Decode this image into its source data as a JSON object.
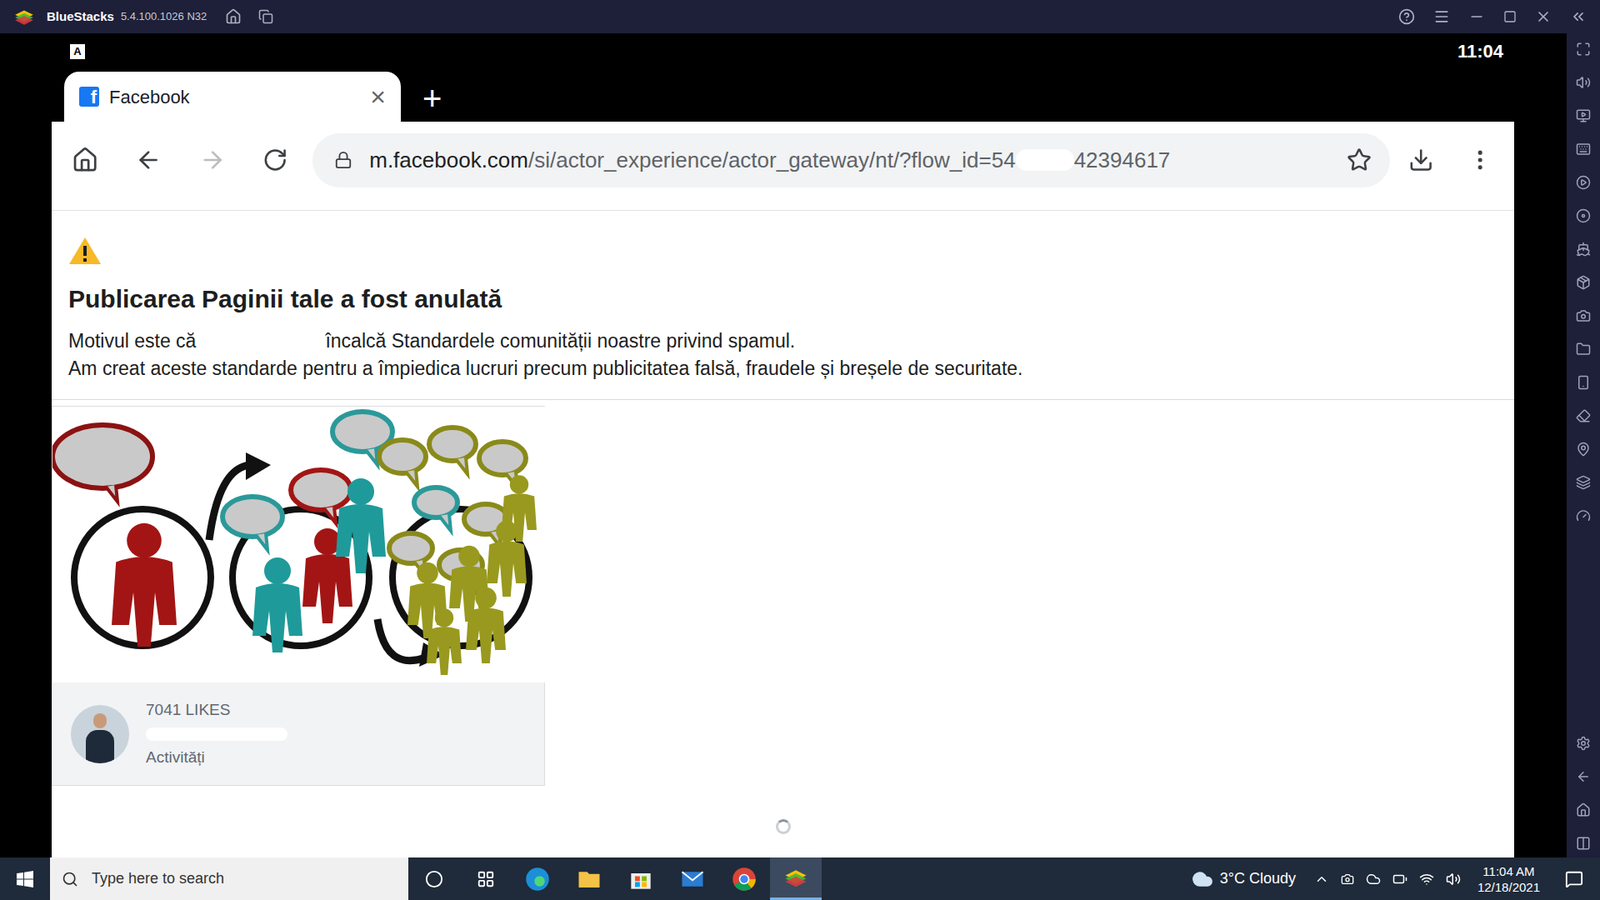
{
  "emulator": {
    "title": "BlueStacks",
    "version": "5.4.100.1026 N32"
  },
  "android_status": {
    "indicator": "A",
    "time": "11:04"
  },
  "browser": {
    "tab": {
      "favicon": "f",
      "title": "Facebook",
      "close": "×",
      "selected": true
    },
    "new_tab": "+",
    "url": {
      "host": "m.facebook.com",
      "path": "/si/actor_experience/actor_gateway/nt/?flow_id=54",
      "tail": "42394617"
    },
    "back_enabled": true,
    "forward_enabled": false,
    "loading": true
  },
  "notice": {
    "heading": "Publicarea Paginii tale a fost anulată",
    "reason_prefix": "Motivul este că",
    "reason_suffix": "încalcă Standardele comunității noastre privind spamul.",
    "explanation": "Am creat aceste standarde pentru a împiedica lucruri precum publicitatea falsă, fraudele și breșele de securitate."
  },
  "page_card": {
    "likes": "7041 LIKES",
    "category": "Activități"
  },
  "taskbar": {
    "search_placeholder": "Type here to search",
    "weather": "3°C Cloudy",
    "time": "11:04 AM",
    "date": "12/18/2021",
    "active_app": "bluestacks"
  }
}
